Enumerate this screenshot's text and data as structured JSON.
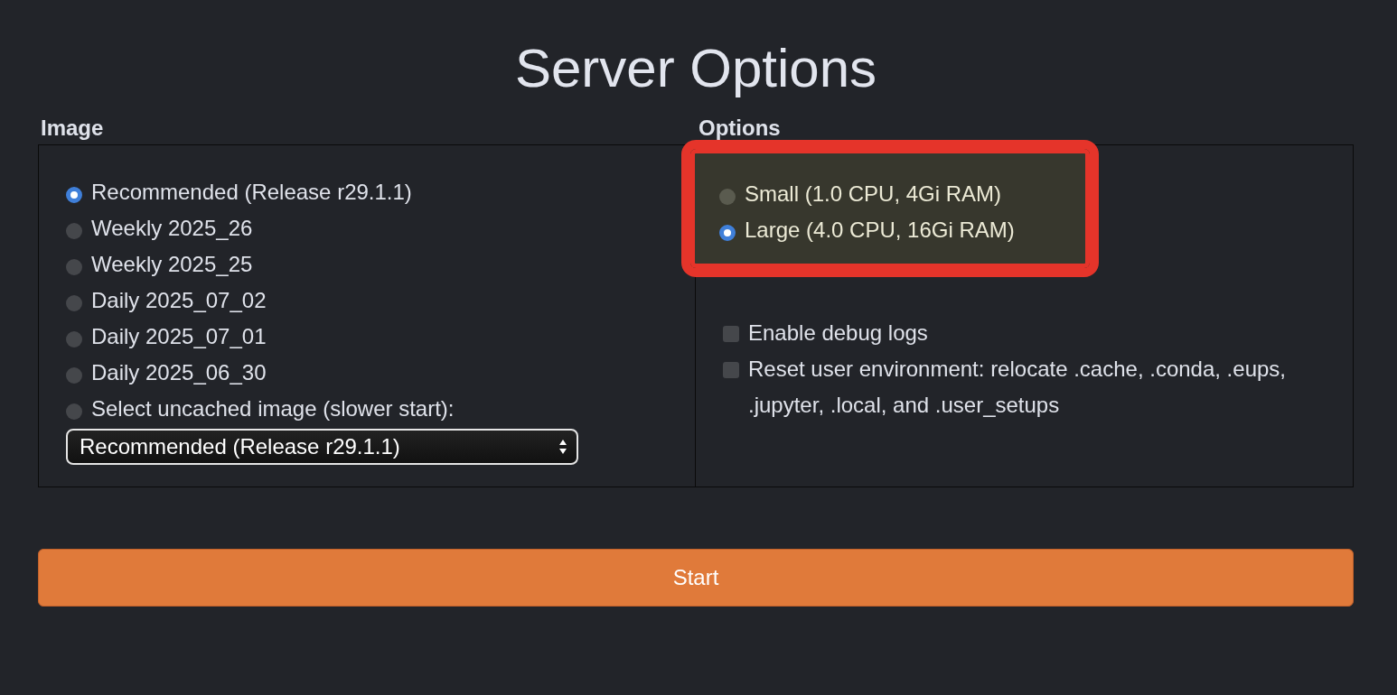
{
  "title": "Server Options",
  "image": {
    "heading": "Image",
    "options": [
      {
        "label": "Recommended (Release r29.1.1)",
        "selected": true
      },
      {
        "label": "Weekly 2025_26",
        "selected": false
      },
      {
        "label": "Weekly 2025_25",
        "selected": false
      },
      {
        "label": "Daily 2025_07_02",
        "selected": false
      },
      {
        "label": "Daily 2025_07_01",
        "selected": false
      },
      {
        "label": "Daily 2025_06_30",
        "selected": false
      },
      {
        "label": "Select uncached image (slower start):",
        "selected": false
      }
    ],
    "dropdown": {
      "value": "Recommended (Release r29.1.1)"
    }
  },
  "options": {
    "heading": "Options",
    "sizes": {
      "highlighted": true,
      "items": [
        {
          "label": "Small (1.0 CPU, 4Gi RAM)",
          "selected": false
        },
        {
          "label": "Large (4.0 CPU, 16Gi RAM)",
          "selected": true
        }
      ]
    },
    "checkboxes": [
      {
        "label": "Enable debug logs",
        "checked": false
      },
      {
        "label": "Reset user environment: relocate .cache, .conda, .eups, .jupyter, .local, and .user_setups",
        "checked": false
      }
    ]
  },
  "start_button": "Start"
}
